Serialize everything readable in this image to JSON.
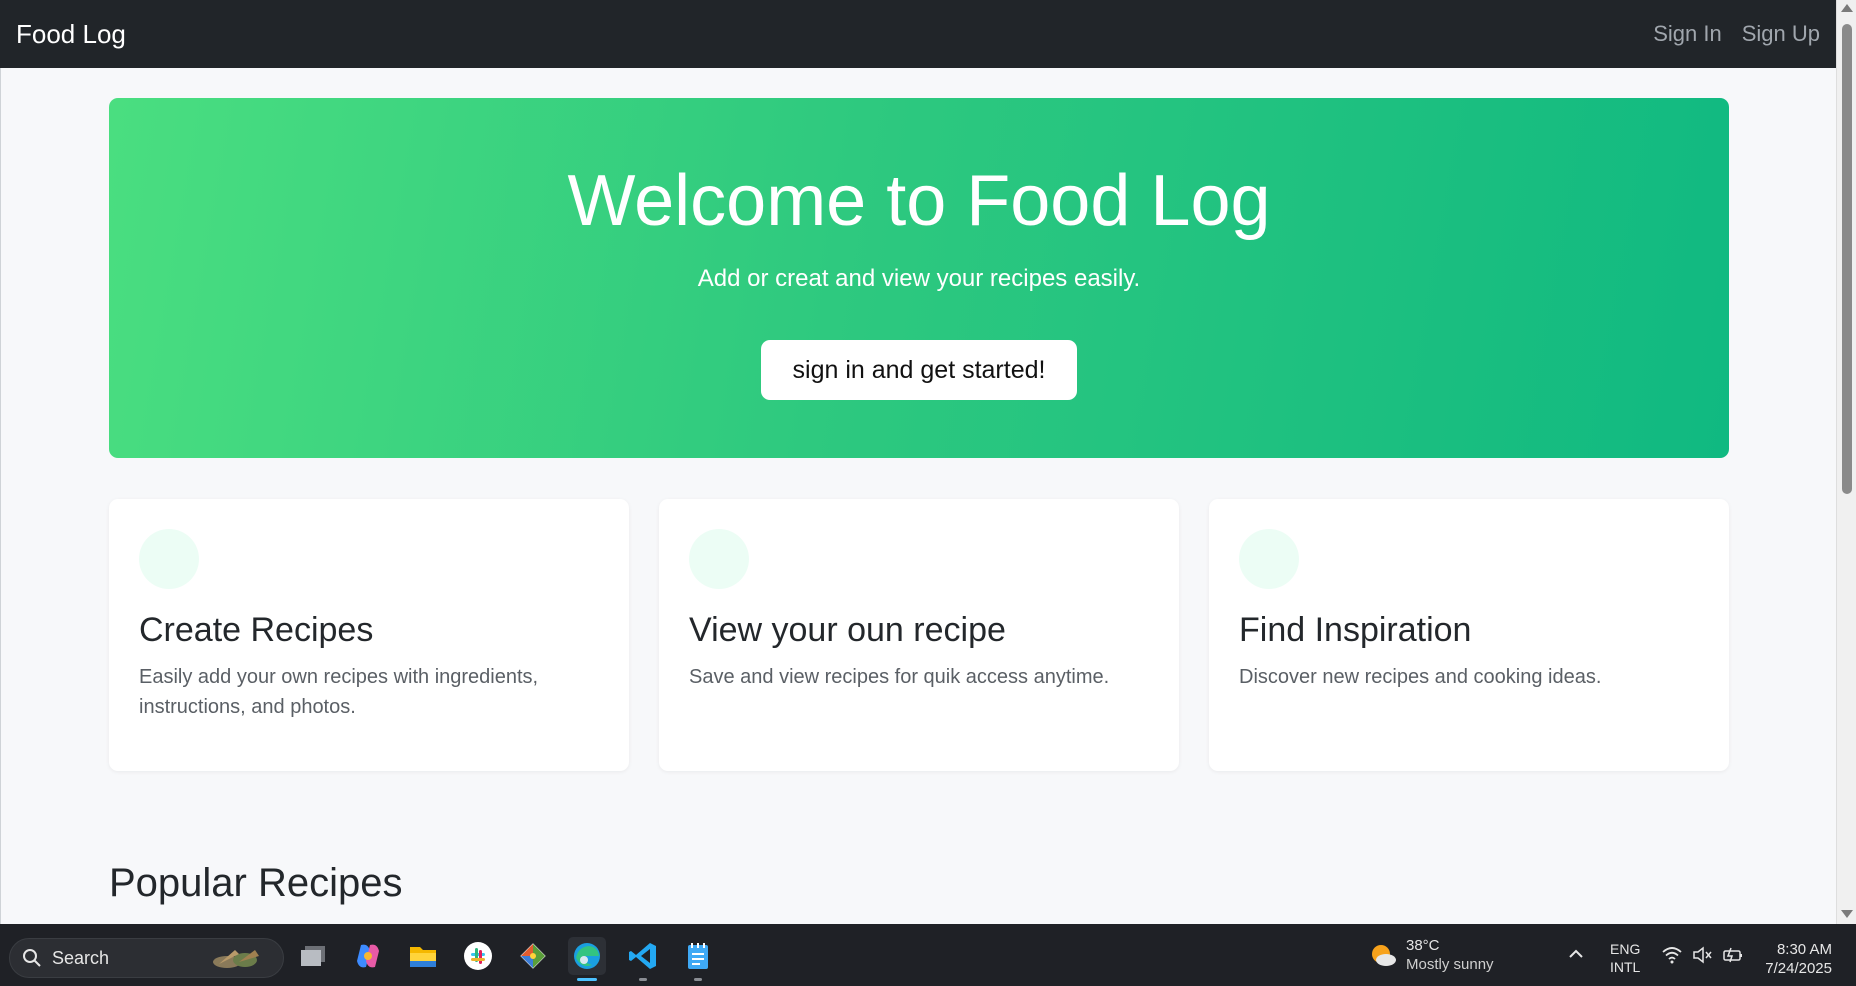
{
  "navbar": {
    "brand": "Food Log",
    "links": [
      {
        "label": "Sign In"
      },
      {
        "label": "Sign Up"
      }
    ]
  },
  "hero": {
    "title": "Welcome to Food Log",
    "subtitle": "Add or creat and view your recipes easily.",
    "cta": "sign in and get started!"
  },
  "features": [
    {
      "title": "Create Recipes",
      "description": "Easily add your own recipes with ingredients, instructions, and photos."
    },
    {
      "title": "View your oun recipe",
      "description": "Save and view recipes for quik access anytime."
    },
    {
      "title": "Find Inspiration",
      "description": "Discover new recipes and cooking ideas."
    }
  ],
  "popular": {
    "heading": "Popular Recipes"
  },
  "colors": {
    "navbar_bg": "#212529",
    "hero_gradient_start": "#4ade80",
    "hero_gradient_end": "#10b981",
    "feature_icon_bg": "#ecfdf5",
    "page_bg": "#f7f8fa"
  },
  "taskbar": {
    "search_label": "Search",
    "apps": [
      "task-view-icon",
      "copilot-icon",
      "file-explorer-icon",
      "slack-icon",
      "git-icon",
      "edge-icon",
      "vscode-icon",
      "notepad-icon"
    ],
    "weather": {
      "temp": "38°C",
      "condition": "Mostly sunny"
    },
    "lang": {
      "line1": "ENG",
      "line2": "INTL"
    },
    "clock": {
      "time": "8:30 AM",
      "date": "7/24/2025"
    }
  }
}
